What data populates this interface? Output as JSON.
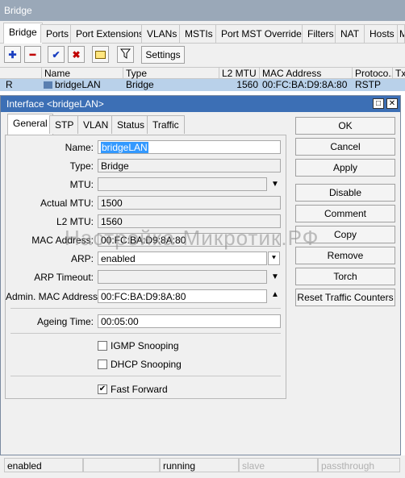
{
  "outer": {
    "title": "Bridge",
    "tabs": [
      "Bridge",
      "Ports",
      "Port Extensions",
      "VLANs",
      "MSTIs",
      "Port MST Overrides",
      "Filters",
      "NAT",
      "Hosts",
      "M"
    ],
    "toolbar": {
      "settings_label": "Settings"
    },
    "columns": [
      "",
      "Name",
      "Type",
      "L2 MTU",
      "MAC Address",
      "Protoco...",
      "Tx"
    ],
    "row": {
      "flag": "R",
      "name": "bridgeLAN",
      "type": "Bridge",
      "l2mtu": "1560",
      "mac": "00:FC:BA:D9:8A:80",
      "protocol": "RSTP"
    },
    "status": {
      "state": "enabled",
      "running": "running",
      "slave": "slave",
      "passthrough": "passthrough"
    }
  },
  "dialog": {
    "title": "Interface <bridgeLAN>",
    "tabs": [
      "General",
      "STP",
      "VLAN",
      "Status",
      "Traffic"
    ],
    "fields": {
      "name_label": "Name:",
      "name_value": "bridgeLAN",
      "type_label": "Type:",
      "type_value": "Bridge",
      "mtu_label": "MTU:",
      "mtu_value": "",
      "actual_mtu_label": "Actual MTU:",
      "actual_mtu_value": "1500",
      "l2mtu_label": "L2 MTU:",
      "l2mtu_value": "1560",
      "mac_label": "MAC Address:",
      "mac_value": "00:FC:BA:D9:8A:80",
      "arp_label": "ARP:",
      "arp_value": "enabled",
      "arp_timeout_label": "ARP Timeout:",
      "arp_timeout_value": "",
      "admin_mac_label": "Admin. MAC Address:",
      "admin_mac_value": "00:FC:BA:D9:8A:80",
      "ageing_label": "Ageing Time:",
      "ageing_value": "00:05:00"
    },
    "checkboxes": {
      "igmp": {
        "label": "IGMP Snooping",
        "checked": false
      },
      "dhcp": {
        "label": "DHCP Snooping",
        "checked": false
      },
      "fast_forward": {
        "label": "Fast Forward",
        "checked": true
      }
    },
    "buttons": [
      "OK",
      "Cancel",
      "Apply",
      "Disable",
      "Comment",
      "Copy",
      "Remove",
      "Torch",
      "Reset Traffic Counters"
    ]
  },
  "watermark": "Настройка-Микротик.РФ",
  "colors": {
    "title_bar": "#3c6fb5",
    "selected_row": "#b9d1ea",
    "selection": "#3399ff"
  }
}
